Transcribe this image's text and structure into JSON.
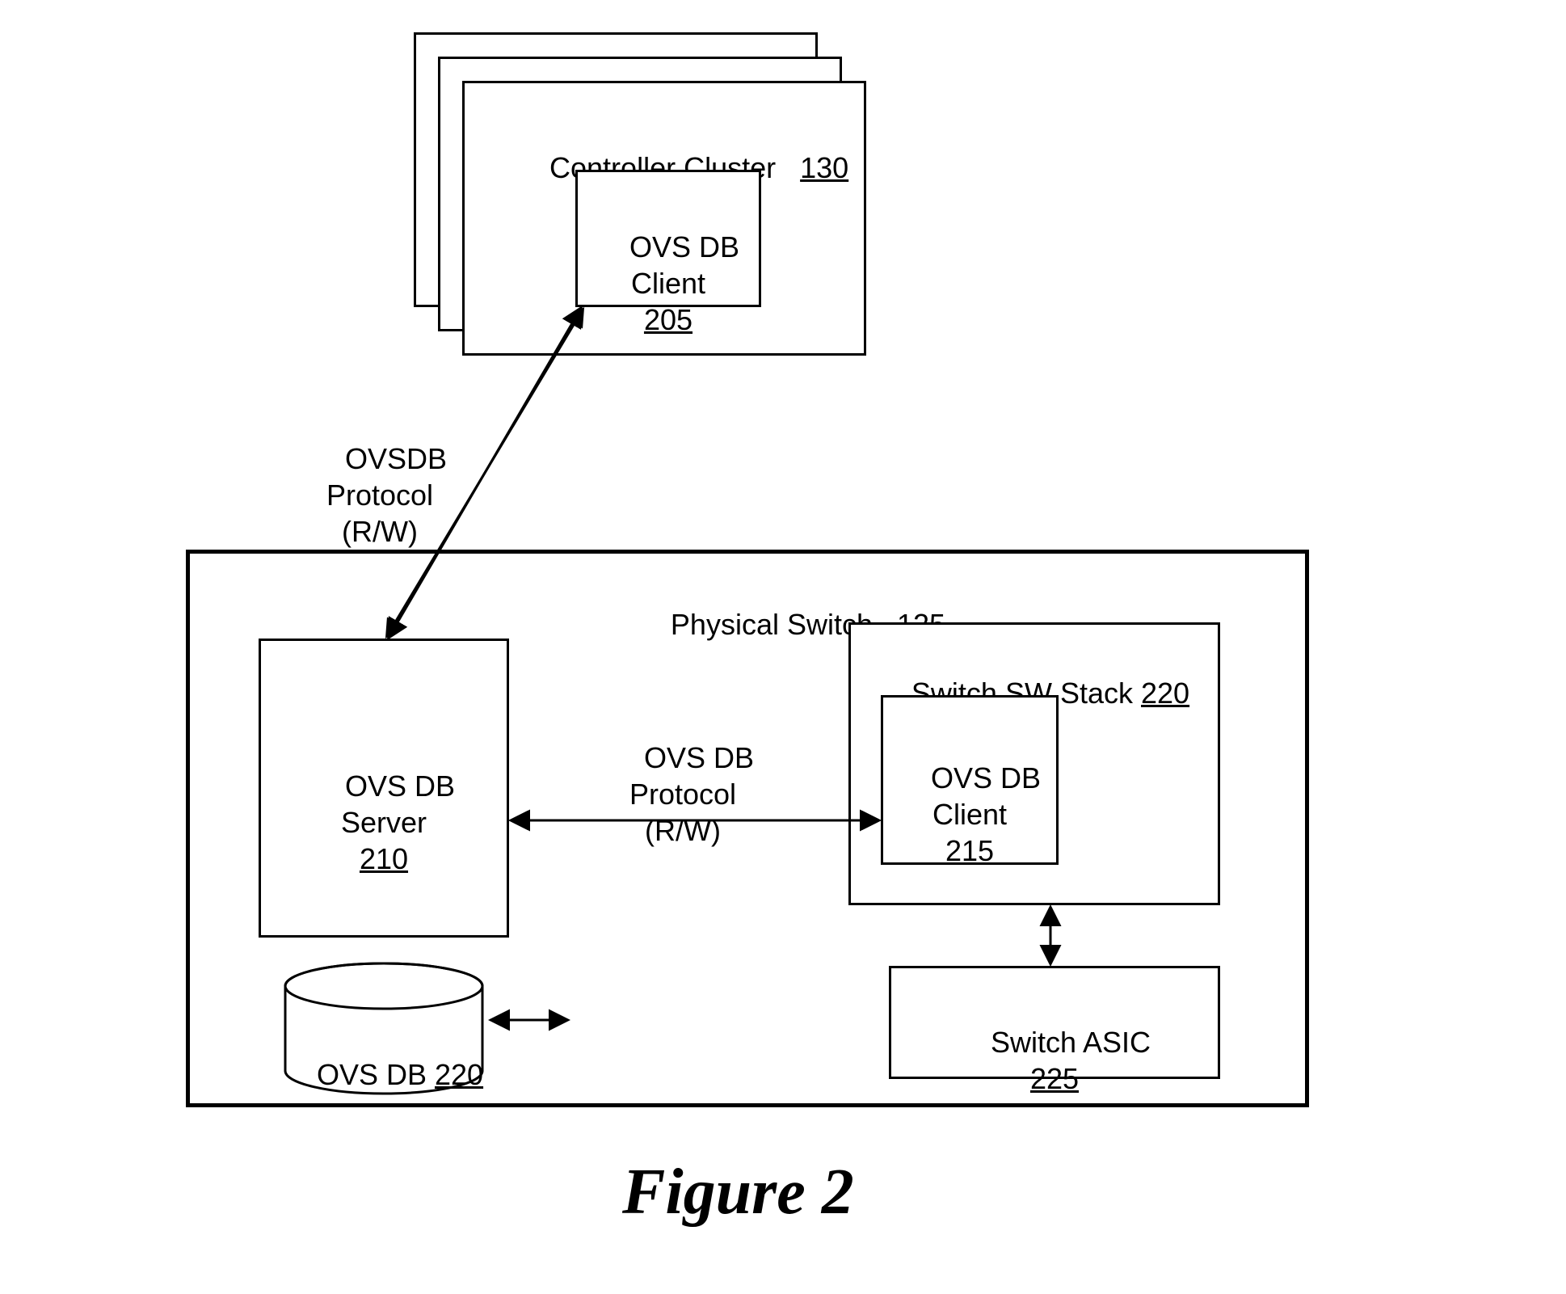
{
  "controller": {
    "title": "Controller Cluster",
    "num": "130",
    "client": {
      "title": "OVS DB\nClient",
      "num": "205"
    }
  },
  "link_cc_server": "OVSDB\nProtocol\n(R/W)",
  "switch": {
    "title": "Physical Switch",
    "num": "125",
    "ovsdb_server": {
      "title": "OVS DB\nServer",
      "num": "210"
    },
    "ovsdb_cyl": {
      "title": "OVS DB",
      "num": "220"
    },
    "link_server_stack": "OVS DB\nProtocol\n(R/W)",
    "sw_stack": {
      "title": "Switch SW Stack",
      "num": "220",
      "client": {
        "title": "OVS DB\nClient",
        "num": "215"
      }
    },
    "asic": {
      "title": "Switch ASIC",
      "num": "225"
    }
  },
  "figure_caption": "Figure 2"
}
